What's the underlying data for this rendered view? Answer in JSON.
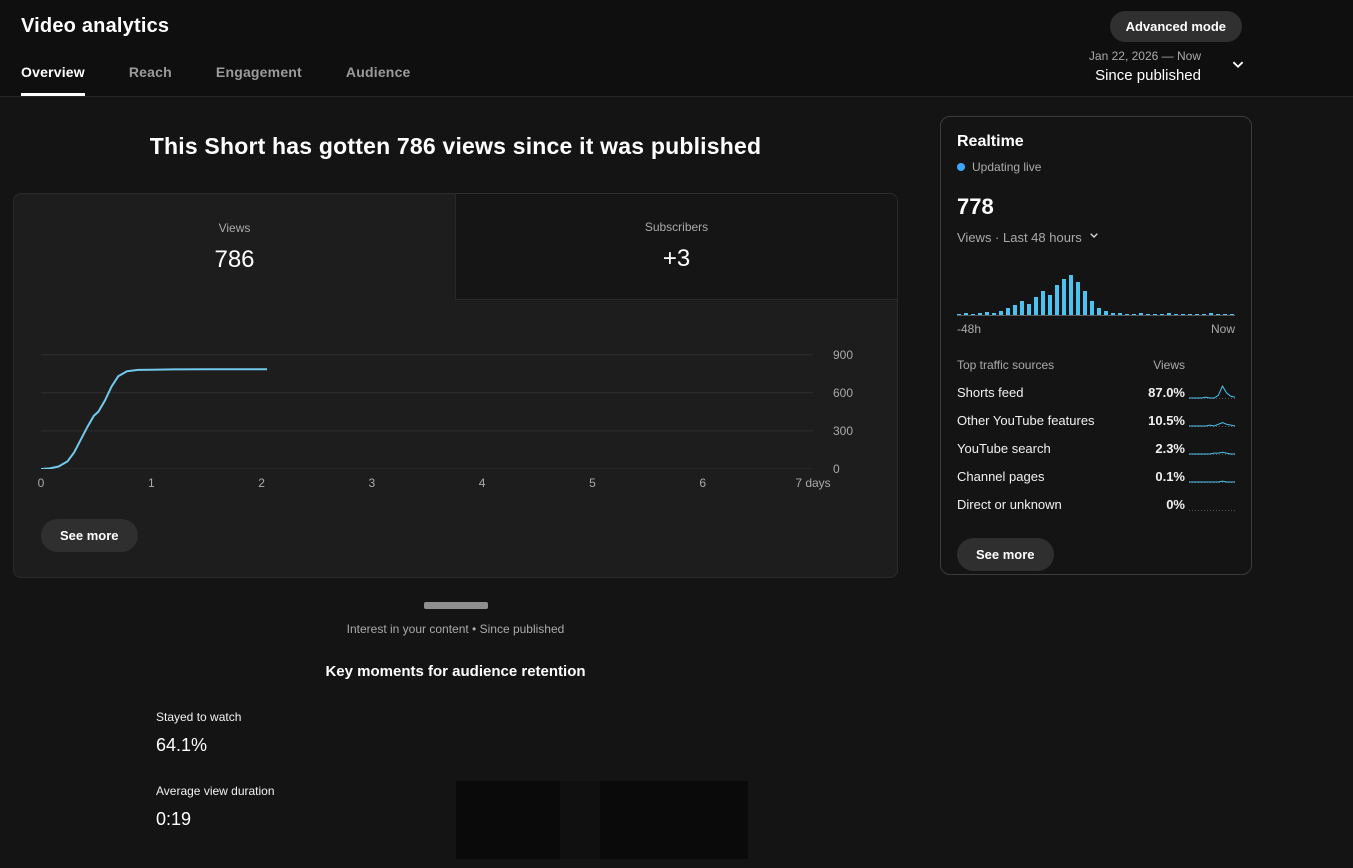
{
  "colors": {
    "accent_blue": "#4cc2f1",
    "line_blue": "#72c9ec",
    "live_dot": "#3ea6ff"
  },
  "page": {
    "title": "Video analytics",
    "advanced_mode_label": "Advanced mode"
  },
  "tabs": [
    {
      "label": "Overview",
      "active": true
    },
    {
      "label": "Reach",
      "active": false
    },
    {
      "label": "Engagement",
      "active": false
    },
    {
      "label": "Audience",
      "active": false
    }
  ],
  "date_filter": {
    "range": "Jan 22, 2026 — Now",
    "label": "Since published"
  },
  "headline": "This Short has gotten 786 views since it was published",
  "metric_card": {
    "tabs": [
      {
        "label": "Views",
        "value": "786",
        "selected": true
      },
      {
        "label": "Subscribers",
        "value": "+3",
        "selected": false
      }
    ],
    "see_more_label": "See more"
  },
  "chart_data": [
    {
      "type": "line",
      "name": "views-since-published",
      "title": "Views since published",
      "x_days": [
        0,
        0.08,
        0.16,
        0.24,
        0.3,
        0.36,
        0.42,
        0.48,
        0.52,
        0.58,
        0.64,
        0.7,
        0.78,
        0.88,
        1.0,
        1.2,
        1.5,
        1.8,
        2.05
      ],
      "y_views": [
        0,
        5,
        20,
        60,
        130,
        230,
        330,
        420,
        450,
        540,
        650,
        730,
        770,
        780,
        782,
        784,
        785,
        786,
        786
      ],
      "x_ticks": [
        "0",
        "1",
        "2",
        "3",
        "4",
        "5",
        "6",
        "7 days"
      ],
      "y_ticks": [
        900,
        600,
        300,
        0
      ],
      "xlim": [
        0,
        7
      ],
      "ylim": [
        0,
        1000
      ],
      "grid": true,
      "legend": "none"
    },
    {
      "type": "bar",
      "name": "realtime-views-48h",
      "title": "Views · Last 48 hours",
      "values": [
        1,
        2,
        1,
        2,
        3,
        2,
        4,
        7,
        10,
        14,
        11,
        18,
        24,
        20,
        30,
        36,
        40,
        33,
        24,
        14,
        7,
        4,
        2,
        2,
        1,
        1,
        2,
        1,
        1,
        1,
        2,
        1,
        1,
        1,
        1,
        1,
        2,
        1,
        1,
        1
      ],
      "x_left_label": "-48h",
      "x_right_label": "Now",
      "ylim": [
        0,
        46
      ]
    }
  ],
  "realtime": {
    "title": "Realtime",
    "updating_label": "Updating live",
    "count": "778",
    "count_label": "Views · Last 48 hours",
    "axis_left": "-48h",
    "axis_right": "Now",
    "traffic": {
      "header_source": "Top traffic sources",
      "header_views": "Views",
      "rows": [
        {
          "source": "Shorts feed",
          "value": "87.0%",
          "spark": [
            0,
            0,
            0,
            0,
            1,
            0,
            0,
            3,
            14,
            6,
            2,
            1
          ]
        },
        {
          "source": "Other YouTube features",
          "value": "10.5%",
          "spark": [
            0,
            0,
            0,
            0,
            0,
            1,
            0,
            2,
            4,
            2,
            1,
            0
          ]
        },
        {
          "source": "YouTube search",
          "value": "2.3%",
          "spark": [
            0,
            0,
            0,
            0,
            0,
            0,
            1,
            1,
            2,
            1,
            0,
            0
          ]
        },
        {
          "source": "Channel pages",
          "value": "0.1%",
          "spark": [
            0,
            0,
            0,
            0,
            0,
            0,
            0,
            0,
            1,
            0,
            0,
            0
          ]
        },
        {
          "source": "Direct or unknown",
          "value": "0%",
          "spark": [
            0,
            0,
            0,
            0,
            0,
            0,
            0,
            0,
            0,
            0,
            0,
            0
          ]
        }
      ]
    },
    "see_more_label": "See more"
  },
  "key_moments": {
    "context": "Interest in your content • Since published",
    "title": "Key moments for audience retention",
    "metrics": [
      {
        "label": "Stayed to watch",
        "value": "64.1%"
      },
      {
        "label": "Average view duration",
        "value": "0:19"
      }
    ]
  }
}
